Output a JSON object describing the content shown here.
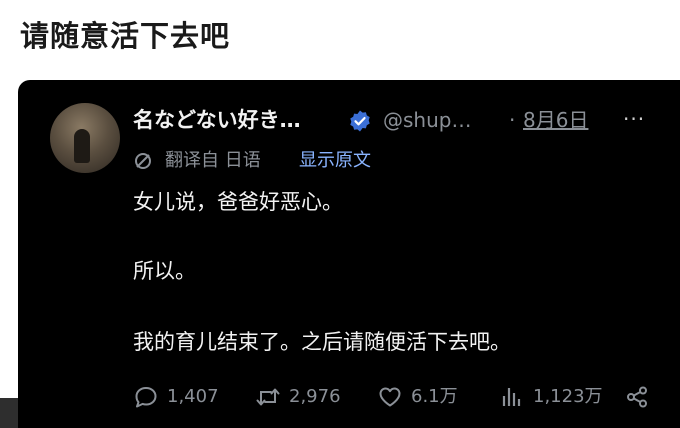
{
  "heading": "请随意活下去吧",
  "tweet": {
    "display_name": "名などない好き…",
    "handle": "@shup…",
    "dot": "·",
    "date": "8月6日",
    "more": "···",
    "translate_label": "翻译自 日语",
    "show_original": "显示原文",
    "lines": [
      "女儿说，爸爸好恶心。",
      "所以。",
      "我的育儿结束了。之后请随便活下去吧。"
    ],
    "stats": {
      "replies": "1,407",
      "retweets": "2,976",
      "likes": "6.1万",
      "views": "1,123万"
    }
  },
  "colors": {
    "background": "#000000",
    "text": "#f2f2f2",
    "muted": "#8b9097",
    "link": "#8ab4ff",
    "verified": "#1d9bf0"
  },
  "icons": [
    "verified-badge-icon",
    "translate-icon",
    "more-icon",
    "reply-icon",
    "retweet-icon",
    "like-icon",
    "views-icon",
    "share-icon"
  ]
}
